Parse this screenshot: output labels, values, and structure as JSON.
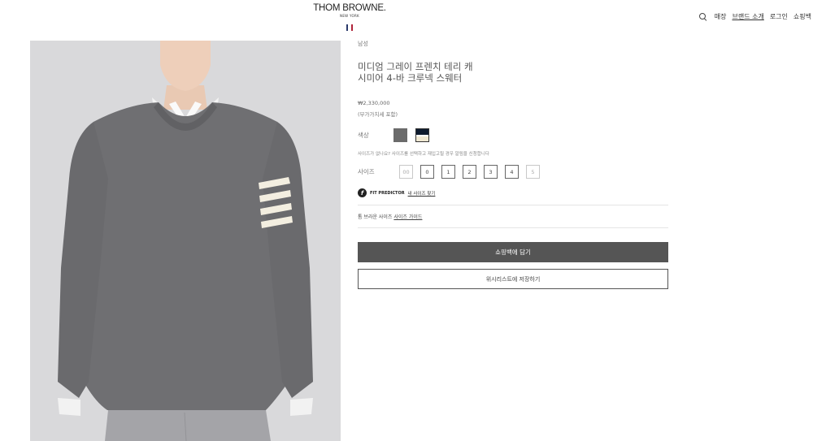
{
  "header": {
    "brand": "THOM BROWNE.",
    "brand_sub": "NEW YORK",
    "flag_colors": [
      "#2b3a6b",
      "#ffffff",
      "#b0243a"
    ],
    "nav": {
      "store": "매장",
      "brand_intro": "브랜드 소개",
      "login": "로그인",
      "bag": "쇼핑백"
    }
  },
  "product": {
    "category": "남성",
    "title_line1": "미디엄 그레이 프렌치 테리 캐",
    "title_line2": "시미어 4-바 크루넥 스웨터",
    "price": "₩2,330,000",
    "vat_note": "(부가가치세 포함)",
    "color_label": "색상",
    "colors": [
      {
        "name": "medium-grey",
        "hex": "#6b6b6b"
      },
      {
        "name": "navy",
        "hex": "#0d1a2e"
      }
    ],
    "size_note": "사이즈가 없나요? 사이즈를 선택하고 재입고될 경우 알림을 신청합니다",
    "size_label": "사이즈",
    "sizes": [
      {
        "label": "00",
        "available": false
      },
      {
        "label": "0",
        "available": true
      },
      {
        "label": "1",
        "available": true
      },
      {
        "label": "2",
        "available": true
      },
      {
        "label": "3",
        "available": true
      },
      {
        "label": "4",
        "available": true
      },
      {
        "label": "5",
        "available": false
      }
    ],
    "fit_predictor": {
      "logo": "f",
      "title": "FIT PREDICTOR",
      "link": "내 사이즈 찾기"
    },
    "guide": {
      "prefix": "톰 브라운 사이즈",
      "link": "사이즈 가이드"
    },
    "add_to_bag": "쇼핑백에 담기",
    "save_wishlist": "위시리스트에 저장하기"
  }
}
